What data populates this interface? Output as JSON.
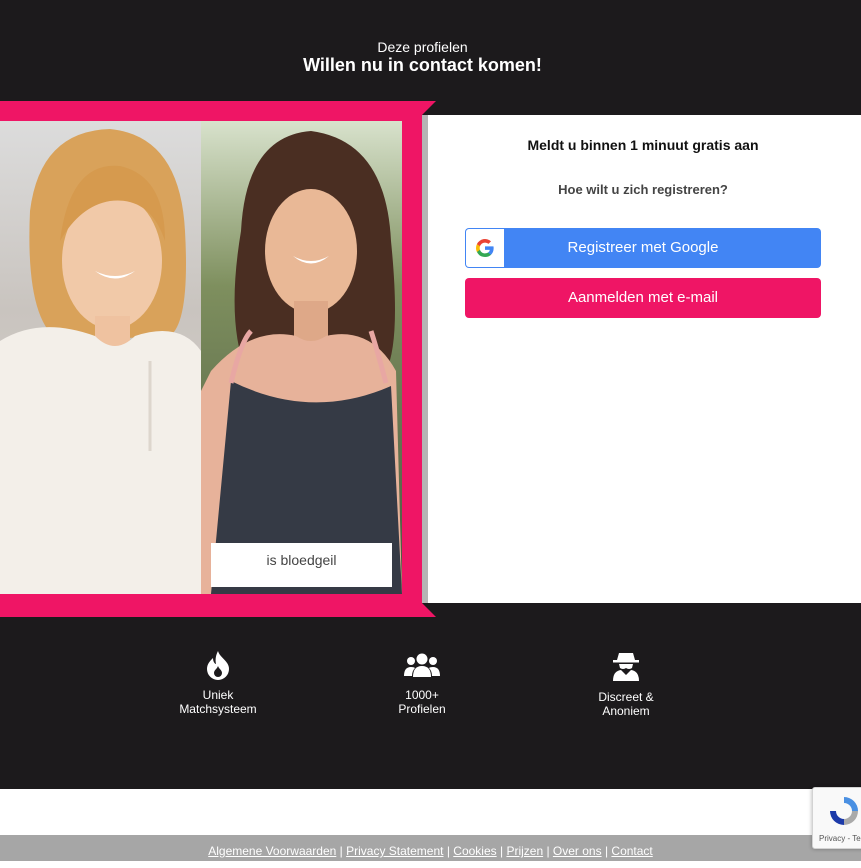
{
  "header": {
    "subtitle": "Deze profielen",
    "title": "Willen nu in contact komen!"
  },
  "profiles": {
    "caption": "is bloedgeil"
  },
  "signup": {
    "title": "Meldt u binnen 1 minuut gratis aan",
    "question": "Hoe wilt u zich registreren?",
    "google_label": "Registreer met Google",
    "email_label": "Aanmelden met e-mail",
    "colors": {
      "google": "#4285f4",
      "email": "#ef1565"
    }
  },
  "features": [
    {
      "icon": "flame-icon",
      "line1": "Uniek",
      "line2": "Matchsysteem"
    },
    {
      "icon": "users-icon",
      "line1": "1000+",
      "line2": "Profielen"
    },
    {
      "icon": "spy-icon",
      "line1": "Discreet &",
      "line2": "Anoniem"
    }
  ],
  "footer": {
    "links": [
      "Algemene Voorwaarden",
      "Privacy Statement",
      "Cookies",
      "Prijzen",
      "Over ons",
      "Contact"
    ]
  },
  "recaptcha": {
    "text": "Privacy - Te"
  },
  "colors": {
    "accent": "#ef1565",
    "dark_bg": "#1c1a1c",
    "footer_bg": "#a6a6a6"
  }
}
